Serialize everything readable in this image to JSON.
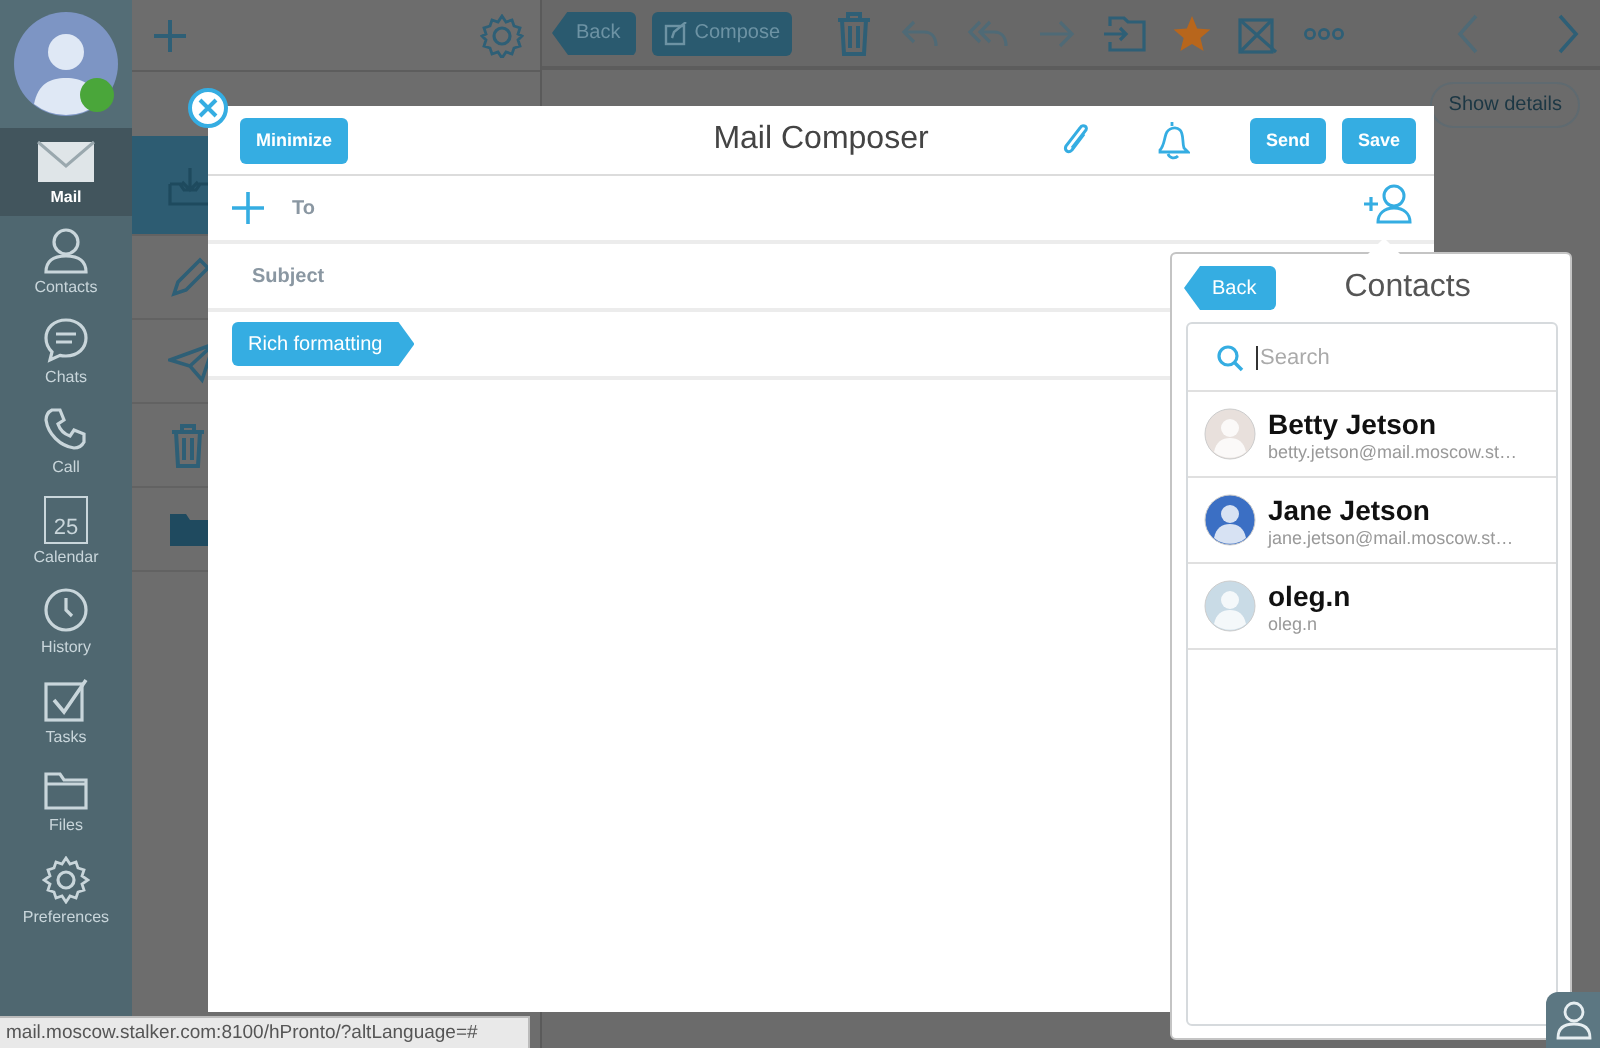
{
  "sidebar": {
    "user": {
      "online": true
    },
    "items": [
      {
        "label": "Mail",
        "selected": true
      },
      {
        "label": "Contacts",
        "selected": false
      },
      {
        "label": "Chats",
        "selected": false
      },
      {
        "label": "Call",
        "selected": false
      },
      {
        "label": "Calendar",
        "selected": false,
        "badge": "25"
      },
      {
        "label": "History",
        "selected": false
      },
      {
        "label": "Tasks",
        "selected": false
      },
      {
        "label": "Files",
        "selected": false
      },
      {
        "label": "Preferences",
        "selected": false
      }
    ]
  },
  "folders": {
    "items": [
      {
        "selected": true
      },
      {
        "selected": false
      },
      {
        "selected": false
      },
      {
        "selected": false
      },
      {
        "selected": false
      }
    ]
  },
  "toolbar": {
    "back": "Back",
    "compose": "Compose",
    "show_details": "Show details"
  },
  "composer": {
    "title": "Mail Composer",
    "minimize": "Minimize",
    "actions": [
      "Send",
      "Save"
    ],
    "to_label": "To",
    "subject_placeholder": "Subject",
    "rich_formatting": "Rich formatting"
  },
  "contacts_popup": {
    "title": "Contacts",
    "back": "Back",
    "search_placeholder": "Search",
    "contacts": [
      {
        "name": "Betty Jetson",
        "email": "betty.jetson@mail.moscow.st…",
        "color": "#e8e0dc"
      },
      {
        "name": "Jane Jetson",
        "email": "jane.jetson@mail.moscow.st…",
        "color": "#3b6fc4"
      },
      {
        "name": "oleg.n",
        "email": "oleg.n",
        "color": "#c9dbe6"
      }
    ]
  },
  "status_bar": "mail.moscow.stalker.com:8100/hPronto/?altLanguage=#"
}
